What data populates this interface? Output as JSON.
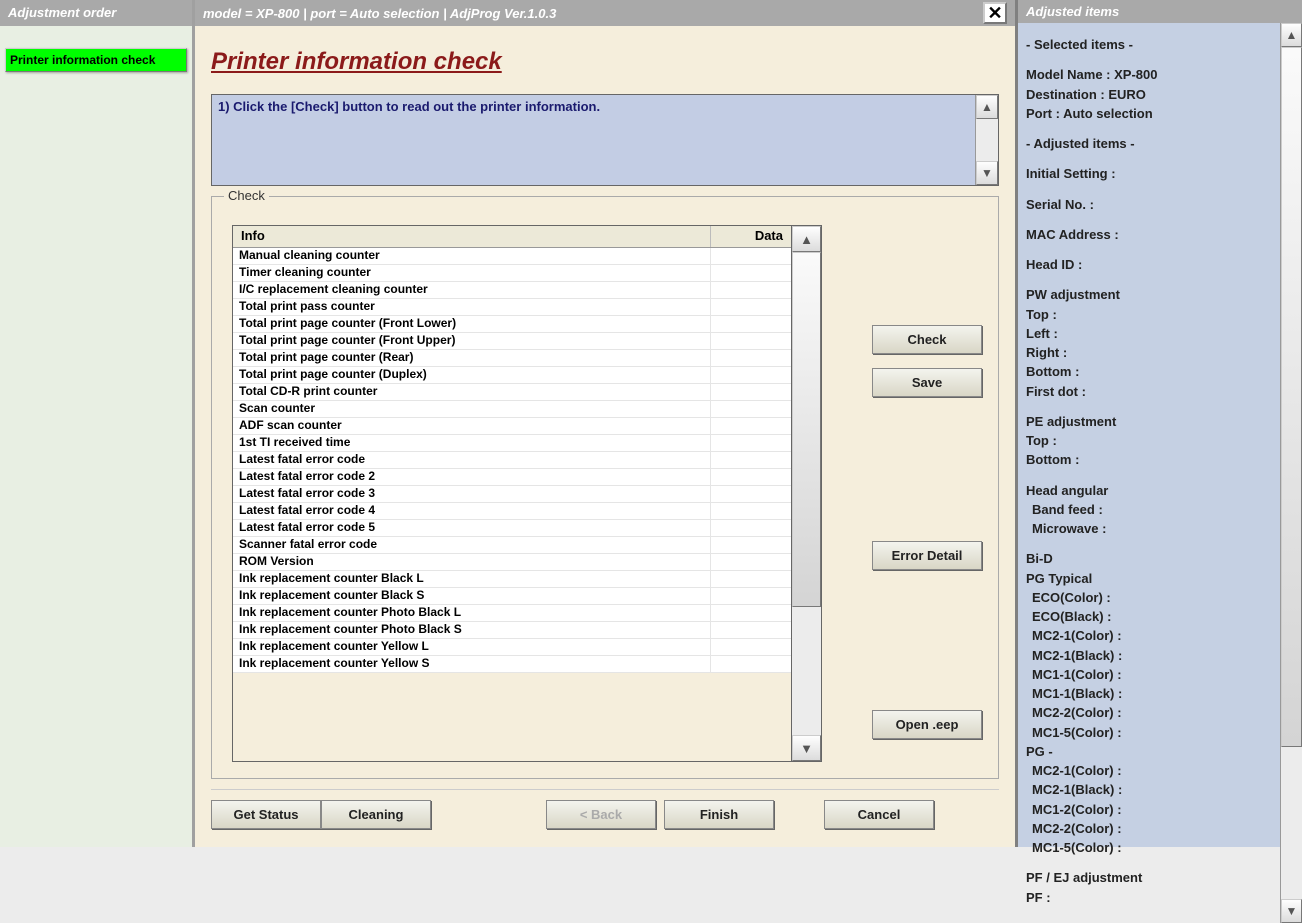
{
  "left": {
    "header": "Adjustment order",
    "items": [
      "Printer information check"
    ]
  },
  "center": {
    "header": "model = XP-800 | port = Auto selection | AdjProg Ver.1.0.3",
    "title": "Printer information check",
    "instruction": "1) Click the [Check] button to read out the printer information.",
    "fieldset_caption": "Check",
    "table": {
      "col_info": "Info",
      "col_data": "Data",
      "rows": [
        {
          "info": "Manual cleaning counter",
          "data": ""
        },
        {
          "info": "Timer cleaning counter",
          "data": ""
        },
        {
          "info": "I/C replacement cleaning counter",
          "data": ""
        },
        {
          "info": "Total print pass counter",
          "data": ""
        },
        {
          "info": "Total print page counter (Front Lower)",
          "data": ""
        },
        {
          "info": "Total print page counter (Front Upper)",
          "data": ""
        },
        {
          "info": "Total print page counter (Rear)",
          "data": ""
        },
        {
          "info": "Total print page counter (Duplex)",
          "data": ""
        },
        {
          "info": "Total CD-R print counter",
          "data": ""
        },
        {
          "info": "Scan counter",
          "data": ""
        },
        {
          "info": "ADF scan counter",
          "data": ""
        },
        {
          "info": "1st TI received time",
          "data": ""
        },
        {
          "info": "Latest fatal error code",
          "data": ""
        },
        {
          "info": "Latest fatal error code 2",
          "data": ""
        },
        {
          "info": "Latest fatal error code 3",
          "data": ""
        },
        {
          "info": "Latest fatal error code 4",
          "data": ""
        },
        {
          "info": "Latest fatal error code 5",
          "data": ""
        },
        {
          "info": "Scanner fatal error code",
          "data": ""
        },
        {
          "info": "ROM Version",
          "data": ""
        },
        {
          "info": "Ink replacement counter Black L",
          "data": ""
        },
        {
          "info": "Ink replacement counter Black S",
          "data": ""
        },
        {
          "info": "Ink replacement counter Photo Black L",
          "data": ""
        },
        {
          "info": "Ink replacement counter Photo Black S",
          "data": ""
        },
        {
          "info": "Ink replacement counter Yellow L",
          "data": ""
        },
        {
          "info": "Ink replacement counter Yellow S",
          "data": ""
        }
      ]
    },
    "buttons": {
      "check": "Check",
      "save": "Save",
      "error_detail": "Error Detail",
      "open_eep": "Open .eep",
      "get_status": "Get Status",
      "cleaning": "Cleaning",
      "back": "< Back",
      "finish": "Finish",
      "cancel": "Cancel"
    }
  },
  "right": {
    "header": "Adjusted items",
    "selected_items_hdr": "- Selected items -",
    "model_name": "Model Name : XP-800",
    "destination": "Destination : EURO",
    "port": "Port : Auto selection",
    "adjusted_items_hdr": "- Adjusted items -",
    "initial_setting": "Initial Setting :",
    "serial_no": "Serial No. :",
    "mac_address": "MAC Address :",
    "head_id": "Head ID :",
    "pw_adjustment": "PW adjustment",
    "pw_top": "Top :",
    "pw_left": "Left :",
    "pw_right": "Right :",
    "pw_bottom": "Bottom :",
    "pw_first_dot": "First dot :",
    "pe_adjustment": "PE adjustment",
    "pe_top": "Top :",
    "pe_bottom": "Bottom :",
    "head_angular": "Head angular",
    "band_feed": " Band feed :",
    "microwave": " Microwave :",
    "bid": "Bi-D",
    "pg_typical": "PG Typical",
    "eco_color": " ECO(Color)  :",
    "eco_black": " ECO(Black)  :",
    "mc2_1_c": " MC2-1(Color) :",
    "mc2_1_b": " MC2-1(Black) :",
    "mc1_1_c": " MC1-1(Color) :",
    "mc1_1_b": " MC1-1(Black) :",
    "mc2_2_c": " MC2-2(Color) :",
    "mc1_5_c": " MC1-5(Color) :",
    "pg_dash": "PG -",
    "pg2_mc2_1_c": " MC2-1(Color) :",
    "pg2_mc2_1_b": " MC2-1(Black) :",
    "pg2_mc1_2_c": " MC1-2(Color) :",
    "pg2_mc2_2_c": " MC2-2(Color) :",
    "pg2_mc1_5_c": " MC1-5(Color) :",
    "pf_ej": "PF / EJ adjustment",
    "pf": "PF :"
  }
}
